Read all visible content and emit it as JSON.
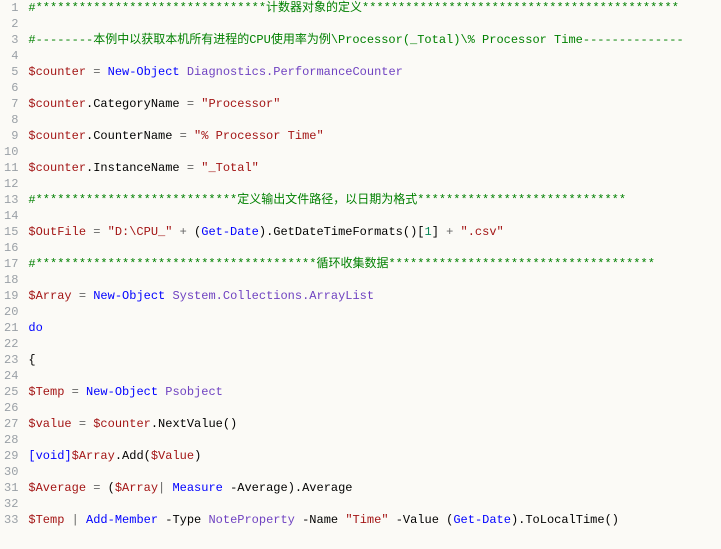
{
  "lines": [
    {
      "n": 1,
      "tokens": [
        {
          "t": "#********************************计数器对象的定义********************************************",
          "c": "c-comment"
        }
      ]
    },
    {
      "n": 2,
      "tokens": []
    },
    {
      "n": 3,
      "tokens": [
        {
          "t": "#--------本例中以获取本机所有进程的CPU使用率为例\\Processor(_Total)\\% Processor Time--------------",
          "c": "c-comment"
        }
      ]
    },
    {
      "n": 4,
      "tokens": []
    },
    {
      "n": 5,
      "tokens": [
        {
          "t": "$counter",
          "c": "c-var"
        },
        {
          "t": " = ",
          "c": "c-op"
        },
        {
          "t": "New-Object",
          "c": "c-kw"
        },
        {
          "t": " ",
          "c": "c-plain"
        },
        {
          "t": "Diagnostics.PerformanceCounter",
          "c": "c-type"
        }
      ]
    },
    {
      "n": 6,
      "tokens": []
    },
    {
      "n": 7,
      "tokens": [
        {
          "t": "$counter",
          "c": "c-var"
        },
        {
          "t": ".CategoryName ",
          "c": "c-plain"
        },
        {
          "t": "=",
          "c": "c-op"
        },
        {
          "t": " ",
          "c": "c-plain"
        },
        {
          "t": "\"Processor\"",
          "c": "c-str"
        }
      ]
    },
    {
      "n": 8,
      "tokens": []
    },
    {
      "n": 9,
      "tokens": [
        {
          "t": "$counter",
          "c": "c-var"
        },
        {
          "t": ".CounterName ",
          "c": "c-plain"
        },
        {
          "t": "=",
          "c": "c-op"
        },
        {
          "t": " ",
          "c": "c-plain"
        },
        {
          "t": "\"% Processor Time\"",
          "c": "c-str"
        }
      ]
    },
    {
      "n": 10,
      "tokens": []
    },
    {
      "n": 11,
      "tokens": [
        {
          "t": "$counter",
          "c": "c-var"
        },
        {
          "t": ".InstanceName ",
          "c": "c-plain"
        },
        {
          "t": "=",
          "c": "c-op"
        },
        {
          "t": " ",
          "c": "c-plain"
        },
        {
          "t": "\"_Total\"",
          "c": "c-str"
        }
      ]
    },
    {
      "n": 12,
      "tokens": []
    },
    {
      "n": 13,
      "tokens": [
        {
          "t": "#****************************定义输出文件路径，以日期为格式*****************************",
          "c": "c-comment"
        }
      ]
    },
    {
      "n": 14,
      "tokens": []
    },
    {
      "n": 15,
      "tokens": [
        {
          "t": "$OutFile",
          "c": "c-var"
        },
        {
          "t": " = ",
          "c": "c-op"
        },
        {
          "t": "\"D:\\CPU_\"",
          "c": "c-str"
        },
        {
          "t": " + ",
          "c": "c-op"
        },
        {
          "t": "(",
          "c": "c-plain"
        },
        {
          "t": "Get-Date",
          "c": "c-kw"
        },
        {
          "t": ")",
          "c": "c-plain"
        },
        {
          "t": ".GetDateTimeFormats()",
          "c": "c-method"
        },
        {
          "t": "[",
          "c": "c-plain"
        },
        {
          "t": "1",
          "c": "c-num"
        },
        {
          "t": "]",
          "c": "c-plain"
        },
        {
          "t": " + ",
          "c": "c-op"
        },
        {
          "t": "\".csv\"",
          "c": "c-str"
        }
      ]
    },
    {
      "n": 16,
      "tokens": []
    },
    {
      "n": 17,
      "tokens": [
        {
          "t": "#***************************************循环收集数据*************************************",
          "c": "c-comment"
        }
      ]
    },
    {
      "n": 18,
      "tokens": []
    },
    {
      "n": 19,
      "tokens": [
        {
          "t": "$Array",
          "c": "c-var"
        },
        {
          "t": " = ",
          "c": "c-op"
        },
        {
          "t": "New-Object",
          "c": "c-kw"
        },
        {
          "t": " ",
          "c": "c-plain"
        },
        {
          "t": "System.Collections.ArrayList",
          "c": "c-type"
        }
      ]
    },
    {
      "n": 20,
      "tokens": []
    },
    {
      "n": 21,
      "tokens": [
        {
          "t": "do",
          "c": "c-kw"
        }
      ]
    },
    {
      "n": 22,
      "tokens": []
    },
    {
      "n": 23,
      "tokens": [
        {
          "t": "{",
          "c": "c-plain"
        }
      ]
    },
    {
      "n": 24,
      "tokens": []
    },
    {
      "n": 25,
      "tokens": [
        {
          "t": "$Temp",
          "c": "c-var"
        },
        {
          "t": " = ",
          "c": "c-op"
        },
        {
          "t": "New-Object",
          "c": "c-kw"
        },
        {
          "t": " ",
          "c": "c-plain"
        },
        {
          "t": "Psobject",
          "c": "c-type"
        }
      ]
    },
    {
      "n": 26,
      "tokens": []
    },
    {
      "n": 27,
      "tokens": [
        {
          "t": "$value",
          "c": "c-var"
        },
        {
          "t": " = ",
          "c": "c-op"
        },
        {
          "t": "$counter",
          "c": "c-var"
        },
        {
          "t": ".NextValue()",
          "c": "c-method"
        }
      ]
    },
    {
      "n": 28,
      "tokens": []
    },
    {
      "n": 29,
      "tokens": [
        {
          "t": "[",
          "c": "c-brkt"
        },
        {
          "t": "void",
          "c": "c-kw"
        },
        {
          "t": "]",
          "c": "c-brkt"
        },
        {
          "t": "$Array",
          "c": "c-var"
        },
        {
          "t": ".Add(",
          "c": "c-method"
        },
        {
          "t": "$Value",
          "c": "c-var"
        },
        {
          "t": ")",
          "c": "c-method"
        }
      ]
    },
    {
      "n": 30,
      "tokens": []
    },
    {
      "n": 31,
      "tokens": [
        {
          "t": "$Average",
          "c": "c-var"
        },
        {
          "t": " = ",
          "c": "c-op"
        },
        {
          "t": "(",
          "c": "c-plain"
        },
        {
          "t": "$Array",
          "c": "c-var"
        },
        {
          "t": "| ",
          "c": "c-pipe"
        },
        {
          "t": "Measure",
          "c": "c-kw"
        },
        {
          "t": " -Average",
          "c": "c-plain"
        },
        {
          "t": ")",
          "c": "c-plain"
        },
        {
          "t": ".Average",
          "c": "c-method"
        }
      ]
    },
    {
      "n": 32,
      "tokens": []
    },
    {
      "n": 33,
      "tokens": [
        {
          "t": "$Temp",
          "c": "c-var"
        },
        {
          "t": " ",
          "c": "c-plain"
        },
        {
          "t": "|",
          "c": "c-pipe"
        },
        {
          "t": " ",
          "c": "c-plain"
        },
        {
          "t": "Add-Member",
          "c": "c-kw"
        },
        {
          "t": " -Type ",
          "c": "c-plain"
        },
        {
          "t": "NoteProperty",
          "c": "c-type"
        },
        {
          "t": " -Name ",
          "c": "c-plain"
        },
        {
          "t": "\"Time\"",
          "c": "c-str"
        },
        {
          "t": " -Value ",
          "c": "c-plain"
        },
        {
          "t": "(",
          "c": "c-plain"
        },
        {
          "t": "Get-Date",
          "c": "c-kw"
        },
        {
          "t": ")",
          "c": "c-plain"
        },
        {
          "t": ".ToLocalTime()",
          "c": "c-method"
        }
      ]
    }
  ]
}
